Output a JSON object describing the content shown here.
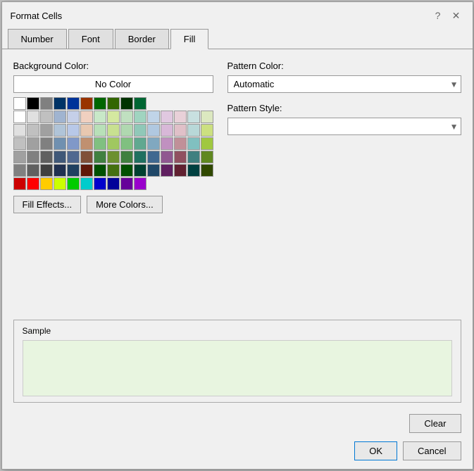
{
  "dialog": {
    "title": "Format Cells",
    "help_icon": "?",
    "close_icon": "✕"
  },
  "tabs": [
    {
      "label": "Number",
      "active": false
    },
    {
      "label": "Font",
      "active": false
    },
    {
      "label": "Border",
      "active": false
    },
    {
      "label": "Fill",
      "active": true
    }
  ],
  "fill": {
    "background_color_label": "Background Color:",
    "no_color_button": "No Color",
    "pattern_color_label": "Pattern Color:",
    "pattern_color_value": "Automatic",
    "pattern_style_label": "Pattern Style:",
    "pattern_style_value": "",
    "fill_effects_button": "Fill Effects...",
    "more_colors_button": "More Colors...",
    "sample_label": "Sample",
    "sample_color": "#e8f5e0",
    "clear_button": "Clear",
    "ok_button": "OK",
    "cancel_button": "Cancel"
  },
  "color_rows": [
    [
      "#ffffff",
      "#000000",
      "#808080",
      "#003366",
      "#003399",
      "#993300",
      "#006600",
      "#336600",
      "#003300",
      "#006633"
    ],
    [
      "#ffffff",
      "#e0e0e0",
      "#c0c0c0",
      "#a0b4d0",
      "#c5cfe8",
      "#f0d0c0",
      "#c8e8c8",
      "#d4e8a0",
      "#c0e0c0",
      "#a0d4c0",
      "#c0d4e8",
      "#e0c8e0",
      "#e8d0d8",
      "#c8e0e0",
      "#dce8c0"
    ],
    [
      "#e0e0e0",
      "#c0c0c0",
      "#a0a0a0",
      "#b0c4d8",
      "#b8c8e8",
      "#e8c8b0",
      "#b8e0b8",
      "#c8e090",
      "#b0d8b0",
      "#90c8b8",
      "#b0c8e0",
      "#d8b8d8",
      "#e0c0c8",
      "#b8d8d8",
      "#cce080"
    ],
    [
      "#c0c0c0",
      "#a0a0a0",
      "#808080",
      "#7090b0",
      "#8098c8",
      "#c09070",
      "#80c080",
      "#a0c860",
      "#80c080",
      "#60a890",
      "#80a8c0",
      "#c090c0",
      "#c09098",
      "#80c0c0",
      "#a0c840"
    ],
    [
      "#a0a0a0",
      "#808080",
      "#606060",
      "#405878",
      "#506890",
      "#805038",
      "#408040",
      "#6c9030",
      "#408040",
      "#207060",
      "#406890",
      "#905890",
      "#905060",
      "#408080",
      "#608820"
    ],
    [
      "#808080",
      "#606060",
      "#404040",
      "#203050",
      "#204060",
      "#601808",
      "#005000",
      "#447010",
      "#005000",
      "#004030",
      "#204868",
      "#602060",
      "#602030",
      "#004040",
      "#304800"
    ],
    [
      "#cc0000",
      "#ff0000",
      "#ffcc00",
      "#ccff00",
      "#00cc00",
      "#00cccc",
      "#0000cc",
      "#000099",
      "#660099",
      "#9900cc"
    ]
  ]
}
